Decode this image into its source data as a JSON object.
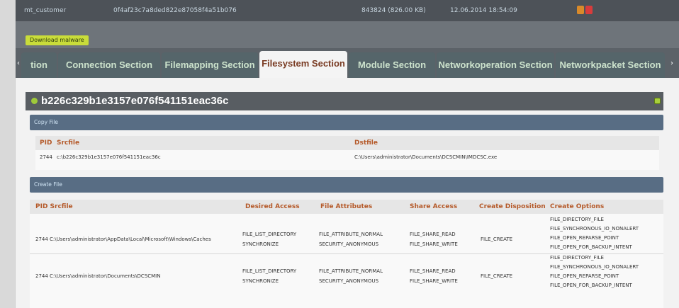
{
  "topbar": {
    "filename": "mt_customer",
    "hash": "0f4af23c7a8ded822e87058f4a51b076",
    "size": "843824 (826.00 KB)",
    "date": "12.06.2014 18:54:09"
  },
  "actions": {
    "download": "Download malware"
  },
  "tabs": [
    {
      "label": "tion"
    },
    {
      "label": "Connection Section"
    },
    {
      "label": "Filemapping Section"
    },
    {
      "label": "Filesystem Section"
    },
    {
      "label": "Module Section"
    },
    {
      "label": "Networkoperation Section"
    },
    {
      "label": "Networkpacket Section"
    }
  ],
  "arrows": {
    "left": "‹",
    "right": "›"
  },
  "section": {
    "title": "b226c329b1e3157e076f541151eac36c"
  },
  "copy_file": {
    "title": "Copy File",
    "columns": {
      "pid": "PID",
      "src": "Srcfile",
      "dst": "Dstfile"
    },
    "rows": [
      {
        "pid": "2744",
        "src": "c:\\b226c329b1e3157e076f541151eac36c",
        "dst": "C:\\Users\\administrator\\Documents\\DCSCMIN\\IMDCSC.exe"
      }
    ]
  },
  "create_file": {
    "title": "Create File",
    "columns": {
      "pid_src": "PID Srcfile",
      "desired": "Desired Access",
      "attrs": "File Attributes",
      "share": "Share Access",
      "disp": "Create Disposition",
      "opts": "Create Options"
    },
    "rows": [
      {
        "pid": "2744",
        "src": "C:\\Users\\administrator\\AppData\\Local\\Microsoft\\Windows\\Caches",
        "desired_1": "FILE_LIST_DIRECTORY",
        "desired_2": "SYNCHRONIZE",
        "attrs_1": "FILE_ATTRIBUTE_NORMAL",
        "attrs_2": "SECURITY_ANONYMOUS",
        "share_1": "FILE_SHARE_READ",
        "share_2": "FILE_SHARE_WRITE",
        "disp": "FILE_CREATE",
        "opt_1": "FILE_DIRECTORY_FILE",
        "opt_2": "FILE_SYNCHRONOUS_IO_NONALERT",
        "opt_3": "FILE_OPEN_REPARSE_POINT",
        "opt_4": "FILE_OPEN_FOR_BACKUP_INTENT"
      },
      {
        "pid": "2744",
        "src": "C:\\Users\\administrator\\Documents\\DCSCMIN",
        "desired_1": "FILE_LIST_DIRECTORY",
        "desired_2": "SYNCHRONIZE",
        "attrs_1": "FILE_ATTRIBUTE_NORMAL",
        "attrs_2": "SECURITY_ANONYMOUS",
        "share_1": "FILE_SHARE_READ",
        "share_2": "FILE_SHARE_WRITE",
        "disp": "FILE_CREATE",
        "opt_1": "FILE_DIRECTORY_FILE",
        "opt_2": "FILE_SYNCHRONOUS_IO_NONALERT",
        "opt_3": "FILE_OPEN_REPARSE_POINT",
        "opt_4": "FILE_OPEN_FOR_BACKUP_INTENT"
      }
    ]
  },
  "colors": {
    "topbar": "#4d5258",
    "tab_bg": "#55656a",
    "tab_text": "#cce2cc",
    "tab_active_text": "#7a3c24",
    "header_text": "#b55a2a",
    "download_btn": "#c9dc3a"
  },
  "icons": {
    "flags": [
      "report-icon",
      "pdf-icon"
    ],
    "section": "leaf-icon",
    "collapse": "collapse-icon"
  }
}
